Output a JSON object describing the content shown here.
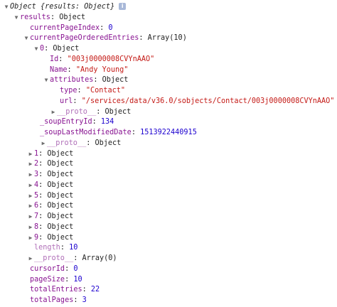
{
  "root": {
    "summary": "Object {results: Object}",
    "info_icon": "info-icon"
  },
  "tree": {
    "results_key": "results",
    "results_type": "Object",
    "currentPageIndex_key": "currentPageIndex",
    "currentPageIndex_val": "0",
    "entries_key": "currentPageOrderedEntries",
    "entries_type": "Array(10)",
    "e0": {
      "key": "0",
      "type": "Object",
      "id_key": "Id",
      "id_val": "\"003j0000008CVYnAAO\"",
      "name_key": "Name",
      "name_val": "\"Andy Young\"",
      "attrs_key": "attributes",
      "attrs_type": "Object",
      "type_key": "type",
      "type_val": "\"Contact\"",
      "url_key": "url",
      "url_val": "\"/services/data/v36.0/sobjects/Contact/003j0000008CVYnAAO\"",
      "proto_key": "__proto__",
      "proto_val": "Object",
      "soupEntryId_key": "_soupEntryId",
      "soupEntryId_val": "134",
      "soupLastMod_key": "_soupLastModifiedDate",
      "soupLastMod_val": "1513922440915",
      "proto2_key": "__proto__",
      "proto2_val": "Object"
    },
    "items": [
      {
        "key": "1",
        "type": "Object"
      },
      {
        "key": "2",
        "type": "Object"
      },
      {
        "key": "3",
        "type": "Object"
      },
      {
        "key": "4",
        "type": "Object"
      },
      {
        "key": "5",
        "type": "Object"
      },
      {
        "key": "6",
        "type": "Object"
      },
      {
        "key": "7",
        "type": "Object"
      },
      {
        "key": "8",
        "type": "Object"
      },
      {
        "key": "9",
        "type": "Object"
      }
    ],
    "length_key": "length",
    "length_val": "10",
    "arr_proto_key": "__proto__",
    "arr_proto_val": "Array(0)",
    "cursorId_key": "cursorId",
    "cursorId_val": "0",
    "pageSize_key": "pageSize",
    "pageSize_val": "10",
    "totalEntries_key": "totalEntries",
    "totalEntries_val": "22",
    "totalPages_key": "totalPages",
    "totalPages_val": "3"
  },
  "colors": {
    "key": "#881391",
    "string": "#c41a16",
    "number": "#1c00cf"
  }
}
